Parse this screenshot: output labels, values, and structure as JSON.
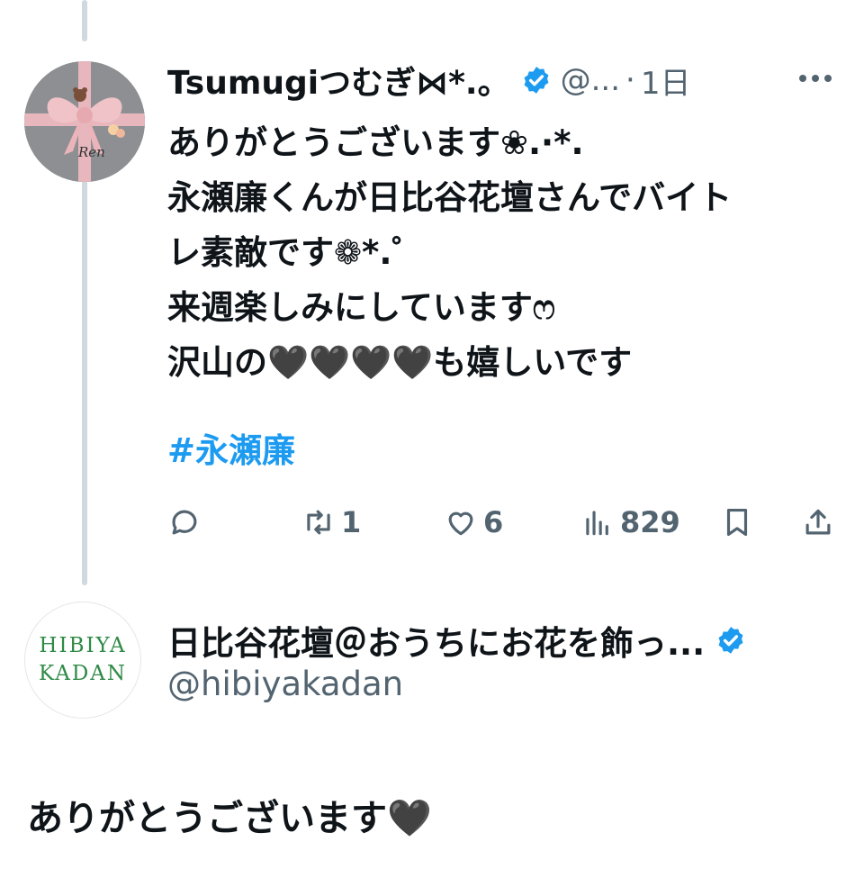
{
  "reply_tweet": {
    "display_name": "Tsumugiつむぎ⋈*.。",
    "handle": "@...",
    "separator": "·",
    "time": "1日",
    "avatar_text": "Ren",
    "lines": [
      "ありがとうございます❀.·*.",
      "永瀬廉くんが日比谷花壇さんでバイト",
      "レ素敵です❁*.゜",
      "来週楽しみにしていますෆ",
      "沢山の🖤🖤🖤🖤も嬉しいです"
    ],
    "hashtag": "#永瀬廉",
    "stats": {
      "replies": "",
      "retweets": "1",
      "likes": "6",
      "views": "829"
    }
  },
  "quoted_account": {
    "display_name": "日比谷花壇＠おうちにお花を飾っ...",
    "handle": "@hibiyakadan",
    "avatar_lines": [
      "HIBIYA",
      "KADAN"
    ]
  },
  "reply_text": "ありがとうございます🖤",
  "colors": {
    "verified": "#1d9bf0",
    "hashtag": "#1d9bf0",
    "secondary_text": "#536471",
    "thread_line": "#cfd9de",
    "brand_green": "#2f8a46"
  },
  "icons": [
    "verified-badge-icon",
    "more-icon",
    "reply-icon",
    "retweet-icon",
    "like-icon",
    "views-icon",
    "bookmark-icon",
    "share-icon"
  ]
}
